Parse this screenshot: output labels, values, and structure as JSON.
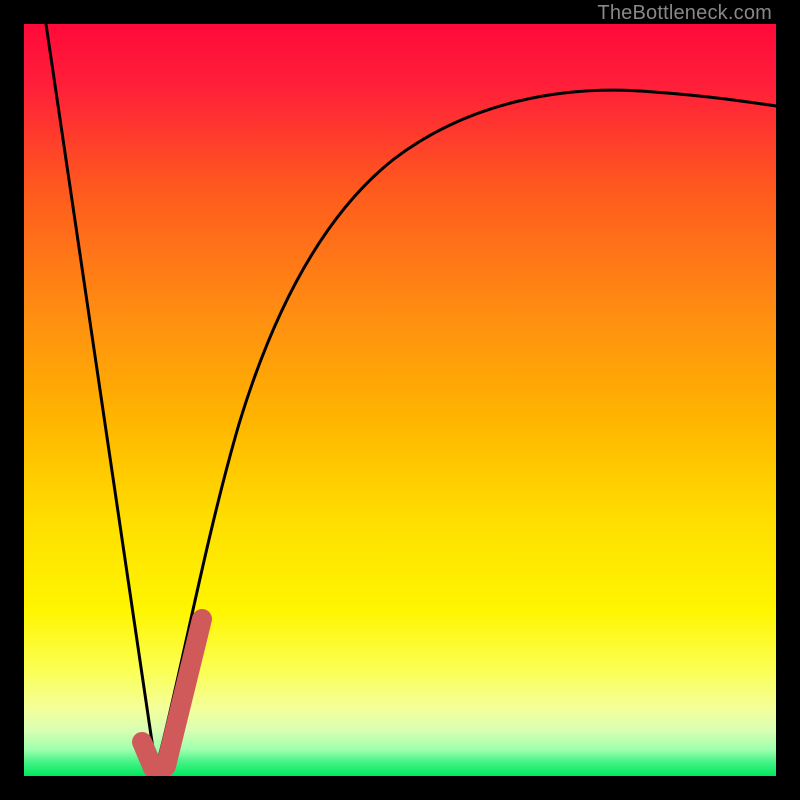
{
  "watermark": "TheBottleneck.com",
  "chart_data": {
    "type": "line",
    "title": "",
    "xlabel": "",
    "ylabel": "",
    "xlim": [
      0,
      100
    ],
    "ylim": [
      0,
      100
    ],
    "grid": false,
    "series": [
      {
        "name": "bottleneck-curve-left",
        "x": [
          0,
          3,
          6,
          9,
          12,
          15,
          17.5
        ],
        "values": [
          100,
          83,
          66,
          49,
          32,
          15,
          0
        ]
      },
      {
        "name": "bottleneck-curve-right",
        "x": [
          17.5,
          20,
          24,
          28,
          32,
          36,
          40,
          45,
          50,
          55,
          60,
          65,
          70,
          75,
          80,
          85,
          90,
          95,
          100
        ],
        "values": [
          0,
          9,
          22,
          34,
          43,
          51,
          57,
          64,
          69,
          73,
          76.5,
          79.5,
          82,
          84,
          85.5,
          86.8,
          87.8,
          88.6,
          89.2
        ]
      },
      {
        "name": "highlighted-segment",
        "x": [
          15,
          17.5,
          20,
          22,
          23.5
        ],
        "values": [
          3,
          0,
          9,
          16,
          21
        ]
      }
    ],
    "highlight_color": "#d05a5a",
    "curve_color": "#000000",
    "background_gradient": {
      "top": "#ff0040",
      "mid1": "#ff8a00",
      "mid2": "#ffe600",
      "low": "#fbff66",
      "band": "#dfffb0",
      "bottom": "#00e85c"
    }
  }
}
